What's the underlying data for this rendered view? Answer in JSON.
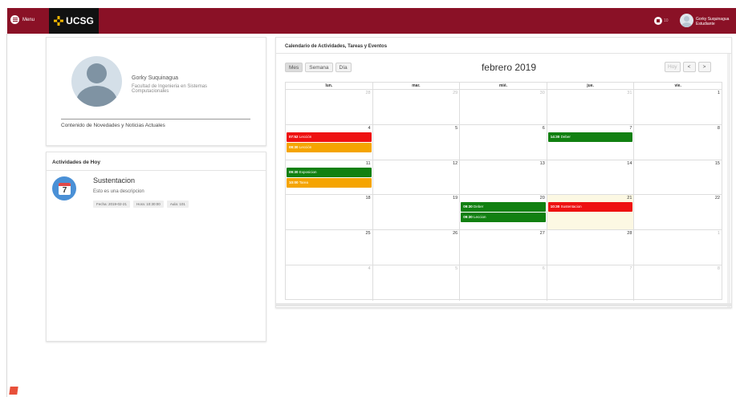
{
  "topbar": {
    "menu_label": "Menu",
    "brand": "UCSG",
    "lock_label": "10",
    "user_name": "Gorky Suquinagua",
    "user_role": "Estudiante",
    "bg": "#8a1126"
  },
  "profile": {
    "name": "Gorky Suquinagua",
    "faculty": "Facultad de Ingenieria en Sistemas Computacionales",
    "news": "Contenido de Novedades y Noticias Actuales"
  },
  "activities": {
    "title": "Actividades de Hoy",
    "icon_day": "7",
    "item": {
      "name": "Sustentacion",
      "description": "Esto es una descripcion",
      "date": "Fecha: 2019-02-21",
      "time": "Hora: 10:30:00",
      "room": "Aula: 101"
    }
  },
  "calendar": {
    "header": "Calendario de Actividades, Tareas y Eventos",
    "views": [
      "Mes",
      "Semana",
      "Día"
    ],
    "active_view": "Mes",
    "month": "febrero 2019",
    "today_label": "Hoy",
    "prev": "<",
    "next": ">",
    "weekdays": [
      "lun.",
      "mar.",
      "mié.",
      "jue.",
      "vie."
    ],
    "colors": {
      "red": "#ee1111",
      "orange": "#f5a400",
      "green": "#118011"
    },
    "weeks": [
      [
        {
          "d": "28",
          "o": true
        },
        {
          "d": "29",
          "o": true
        },
        {
          "d": "30",
          "o": true
        },
        {
          "d": "31",
          "o": true
        },
        {
          "d": "1"
        }
      ],
      [
        {
          "d": "4",
          "ev": [
            {
              "t": "07:52",
              "l": "Lección",
              "c": "red"
            },
            {
              "t": "08:30",
              "l": "Lección",
              "c": "orange"
            }
          ]
        },
        {
          "d": "5"
        },
        {
          "d": "6"
        },
        {
          "d": "7",
          "ev": [
            {
              "t": "14:30",
              "l": "Deber",
              "c": "green"
            }
          ]
        },
        {
          "d": "8"
        }
      ],
      [
        {
          "d": "11",
          "ev": [
            {
              "t": "09:30",
              "l": "Exposicion",
              "c": "green"
            },
            {
              "t": "10:00",
              "l": "Tarea",
              "c": "orange"
            }
          ]
        },
        {
          "d": "12"
        },
        {
          "d": "13"
        },
        {
          "d": "14"
        },
        {
          "d": "15"
        }
      ],
      [
        {
          "d": "18"
        },
        {
          "d": "19"
        },
        {
          "d": "20",
          "ev": [
            {
              "t": "09:30",
              "l": "Deber",
              "c": "green"
            },
            {
              "t": "09:30",
              "l": "Leccion",
              "c": "green"
            }
          ]
        },
        {
          "d": "21",
          "today": true,
          "ev": [
            {
              "t": "10:30",
              "l": "Sustentacion",
              "c": "red"
            }
          ]
        },
        {
          "d": "22"
        }
      ],
      [
        {
          "d": "25"
        },
        {
          "d": "26"
        },
        {
          "d": "27"
        },
        {
          "d": "28"
        },
        {
          "d": "1",
          "o": true
        }
      ],
      [
        {
          "d": "4",
          "o": true
        },
        {
          "d": "5",
          "o": true
        },
        {
          "d": "6",
          "o": true
        },
        {
          "d": "7",
          "o": true
        },
        {
          "d": "8",
          "o": true
        }
      ]
    ]
  }
}
